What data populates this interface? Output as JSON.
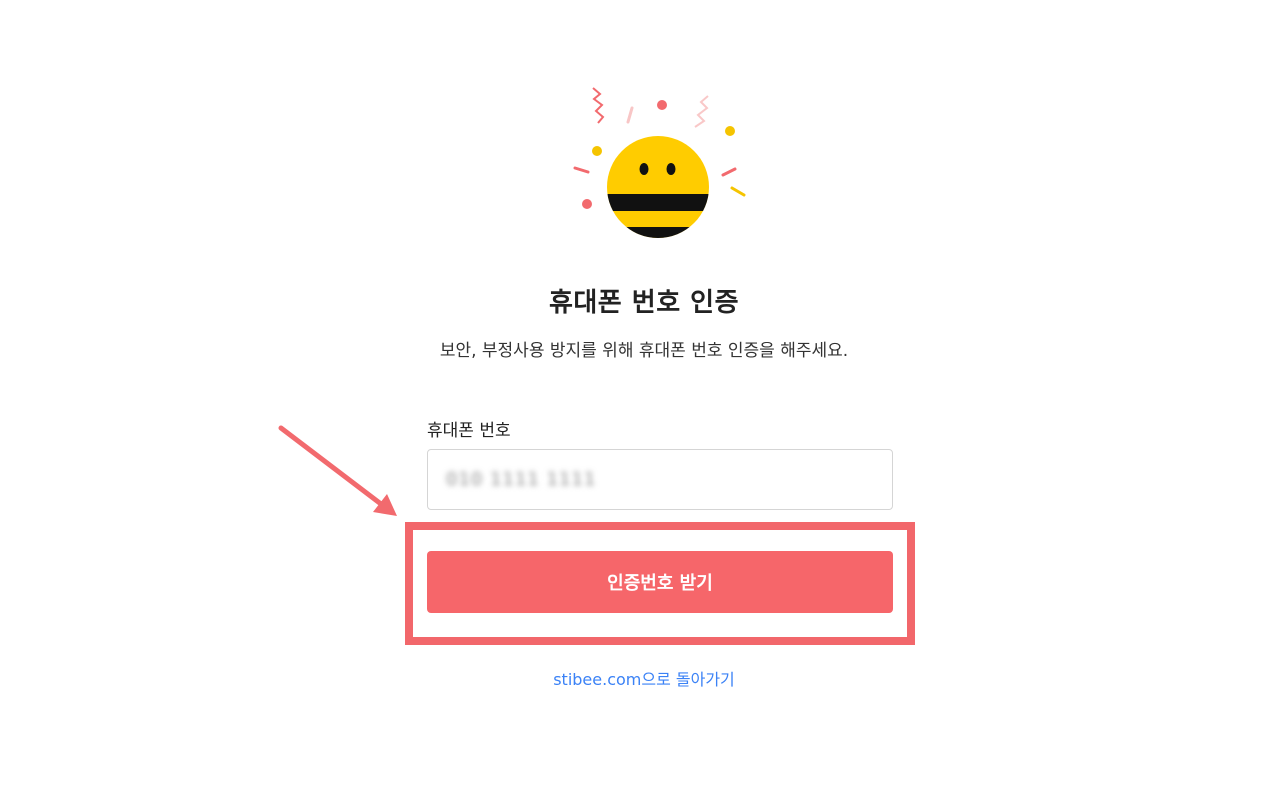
{
  "page": {
    "title": "휴대폰 번호 인증",
    "subtitle": "보안, 부정사용 방지를 위해 휴대폰 번호 인증을 해주세요."
  },
  "form": {
    "phone_label": "휴대폰 번호",
    "phone_value": "010 1111 1111",
    "submit_label": "인증번호 받기"
  },
  "footer": {
    "back_link": "stibee.com으로 돌아가기"
  },
  "icons": {
    "mascot": "smiling-bee-face-icon",
    "arrow": "annotation-arrow-icon"
  },
  "colors": {
    "accent": "#f6666a",
    "highlight": "#f2676b",
    "link": "#3b82f6",
    "mascot_yellow": "#ffcc00",
    "confetti_red": "#f26a6e",
    "confetti_yellow": "#f5c400"
  }
}
